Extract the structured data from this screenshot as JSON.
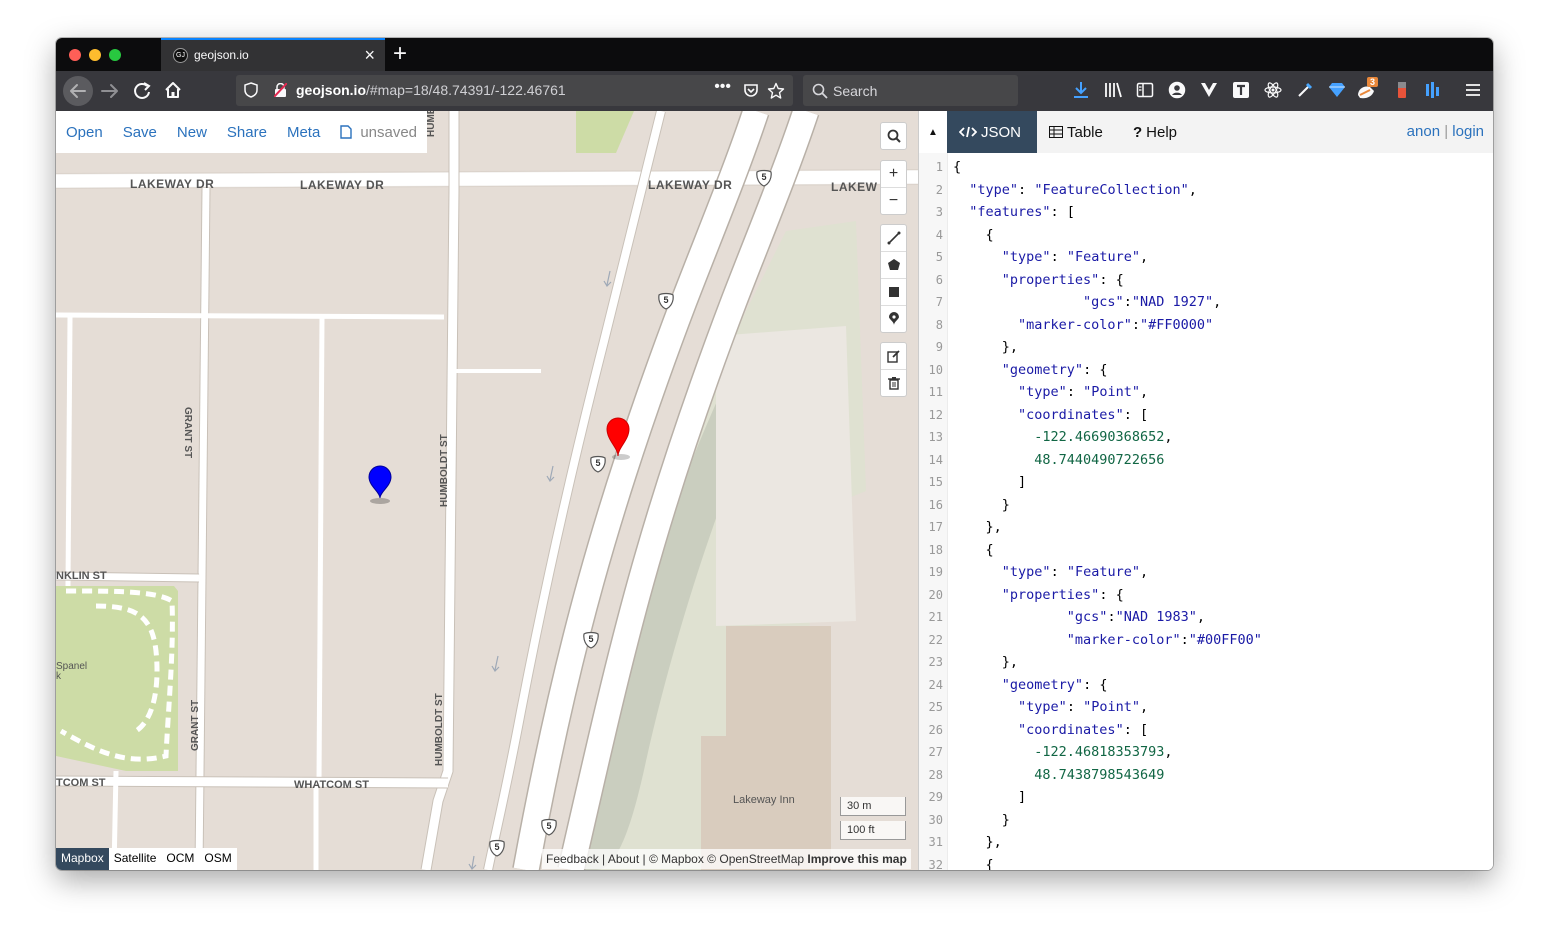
{
  "browser": {
    "tab_title": "geojson.io",
    "tab_favicon": "GJ",
    "url_domain": "geojson.io",
    "url_rest": "/#map=18/48.74391/-122.46761",
    "search_placeholder": "Search",
    "badge_count": "3"
  },
  "app": {
    "menu": [
      "Open",
      "Save",
      "New",
      "Share",
      "Meta"
    ],
    "unsaved_label": "unsaved",
    "panel_tabs": [
      "JSON",
      "Table",
      "Help"
    ],
    "user": "anon",
    "login": "login",
    "separator": "|"
  },
  "map": {
    "streets": {
      "lakeway_1": "LAKEWAY DR",
      "lakeway_2": "LAKEWAY DR",
      "lakeway_3": "LAKEWAY DR",
      "lakeway_4": "LAKEW",
      "humboldt_top": "HUMBOLDT",
      "humboldt_mid": "HUMBOLDT ST",
      "humboldt_low": "HUMBOLDT ST",
      "grant_top": "GRANT ST",
      "grant_low": "GRANT ST",
      "franklin": "NKLIN ST",
      "whatcom_left": "TCOM ST",
      "whatcom": "WHATCOM ST",
      "park": "Spanel",
      "park2": "k",
      "lakeway_inn": "Lakeway Inn",
      "interstate": "5"
    },
    "scale": {
      "metric": "30 m",
      "imperial": "100 ft"
    },
    "layers": [
      "Mapbox",
      "Satellite",
      "OCM",
      "OSM"
    ],
    "active_layer": "Mapbox",
    "attribution": {
      "feedback": "Feedback",
      "about": "About",
      "credits": "© Mapbox © OpenStreetMap",
      "improve": "Improve this map"
    },
    "markers": [
      {
        "color": "#FF0000"
      },
      {
        "color": "#0000FF"
      }
    ]
  },
  "json_lines": [
    [
      [
        "p",
        "{"
      ]
    ],
    [
      [
        "p",
        "  "
      ],
      [
        "k",
        "\"type\""
      ],
      [
        "p",
        ": "
      ],
      [
        "s",
        "\"FeatureCollection\""
      ],
      [
        "p",
        ","
      ]
    ],
    [
      [
        "p",
        "  "
      ],
      [
        "k",
        "\"features\""
      ],
      [
        "p",
        ": ["
      ]
    ],
    [
      [
        "p",
        "    {"
      ]
    ],
    [
      [
        "p",
        "      "
      ],
      [
        "k",
        "\"type\""
      ],
      [
        "p",
        ": "
      ],
      [
        "s",
        "\"Feature\""
      ],
      [
        "p",
        ","
      ]
    ],
    [
      [
        "p",
        "      "
      ],
      [
        "k",
        "\"properties\""
      ],
      [
        "p",
        ": {"
      ]
    ],
    [
      [
        "p",
        "                "
      ],
      [
        "k",
        "\"gcs\""
      ],
      [
        "p",
        ":"
      ],
      [
        "s",
        "\"NAD 1927\""
      ],
      [
        "p",
        ","
      ]
    ],
    [
      [
        "p",
        "        "
      ],
      [
        "k",
        "\"marker-color\""
      ],
      [
        "p",
        ":"
      ],
      [
        "s",
        "\"#FF0000\""
      ]
    ],
    [
      [
        "p",
        "      },"
      ]
    ],
    [
      [
        "p",
        "      "
      ],
      [
        "k",
        "\"geometry\""
      ],
      [
        "p",
        ": {"
      ]
    ],
    [
      [
        "p",
        "        "
      ],
      [
        "k",
        "\"type\""
      ],
      [
        "p",
        ": "
      ],
      [
        "s",
        "\"Point\""
      ],
      [
        "p",
        ","
      ]
    ],
    [
      [
        "p",
        "        "
      ],
      [
        "k",
        "\"coordinates\""
      ],
      [
        "p",
        ": ["
      ]
    ],
    [
      [
        "p",
        "          "
      ],
      [
        "n",
        "-122.46690368652"
      ],
      [
        "p",
        ","
      ]
    ],
    [
      [
        "p",
        "          "
      ],
      [
        "n",
        "48.7440490722656"
      ]
    ],
    [
      [
        "p",
        "        ]"
      ]
    ],
    [
      [
        "p",
        "      }"
      ]
    ],
    [
      [
        "p",
        "    },"
      ]
    ],
    [
      [
        "p",
        "    {"
      ]
    ],
    [
      [
        "p",
        "      "
      ],
      [
        "k",
        "\"type\""
      ],
      [
        "p",
        ": "
      ],
      [
        "s",
        "\"Feature\""
      ],
      [
        "p",
        ","
      ]
    ],
    [
      [
        "p",
        "      "
      ],
      [
        "k",
        "\"properties\""
      ],
      [
        "p",
        ": {"
      ]
    ],
    [
      [
        "p",
        "              "
      ],
      [
        "k",
        "\"gcs\""
      ],
      [
        "p",
        ":"
      ],
      [
        "s",
        "\"NAD 1983\""
      ],
      [
        "p",
        ","
      ]
    ],
    [
      [
        "p",
        "              "
      ],
      [
        "k",
        "\"marker-color\""
      ],
      [
        "p",
        ":"
      ],
      [
        "s",
        "\"#00FF00\""
      ]
    ],
    [
      [
        "p",
        "      },"
      ]
    ],
    [
      [
        "p",
        "      "
      ],
      [
        "k",
        "\"geometry\""
      ],
      [
        "p",
        ": {"
      ]
    ],
    [
      [
        "p",
        "        "
      ],
      [
        "k",
        "\"type\""
      ],
      [
        "p",
        ": "
      ],
      [
        "s",
        "\"Point\""
      ],
      [
        "p",
        ","
      ]
    ],
    [
      [
        "p",
        "        "
      ],
      [
        "k",
        "\"coordinates\""
      ],
      [
        "p",
        ": ["
      ]
    ],
    [
      [
        "p",
        "          "
      ],
      [
        "n",
        "-122.46818353793"
      ],
      [
        "p",
        ","
      ]
    ],
    [
      [
        "p",
        "          "
      ],
      [
        "n",
        "48.7438798543649"
      ]
    ],
    [
      [
        "p",
        "        ]"
      ]
    ],
    [
      [
        "p",
        "      }"
      ]
    ],
    [
      [
        "p",
        "    },"
      ]
    ],
    [
      [
        "p",
        "    {"
      ]
    ]
  ]
}
